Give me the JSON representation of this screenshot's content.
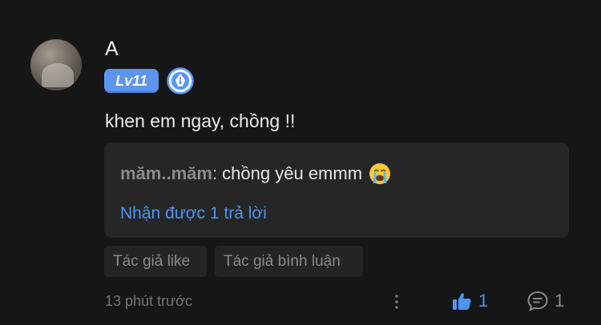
{
  "comment": {
    "username": "A",
    "level": "Lv11",
    "text": "khen em ngay, chồng !!",
    "reply": {
      "author": "măm..măm",
      "text": ": chồng yêu emmm",
      "count_label": "Nhận được 1 trả lời"
    },
    "tags": [
      "Tác giả like",
      "Tác giả bình luận"
    ],
    "time": "13 phút trước",
    "likes": "1",
    "comments": "1"
  },
  "icons": {
    "badge": "pen-nib-badge-icon",
    "emoji": "loudly-crying-face-icon",
    "more": "vertical-dots-icon",
    "like": "thumbs-up-icon",
    "comment": "comment-bubble-icon"
  },
  "colors": {
    "background": "#161616",
    "accent": "#4f93f2",
    "level_badge": "#5b95f0",
    "reply_box": "#262626"
  }
}
